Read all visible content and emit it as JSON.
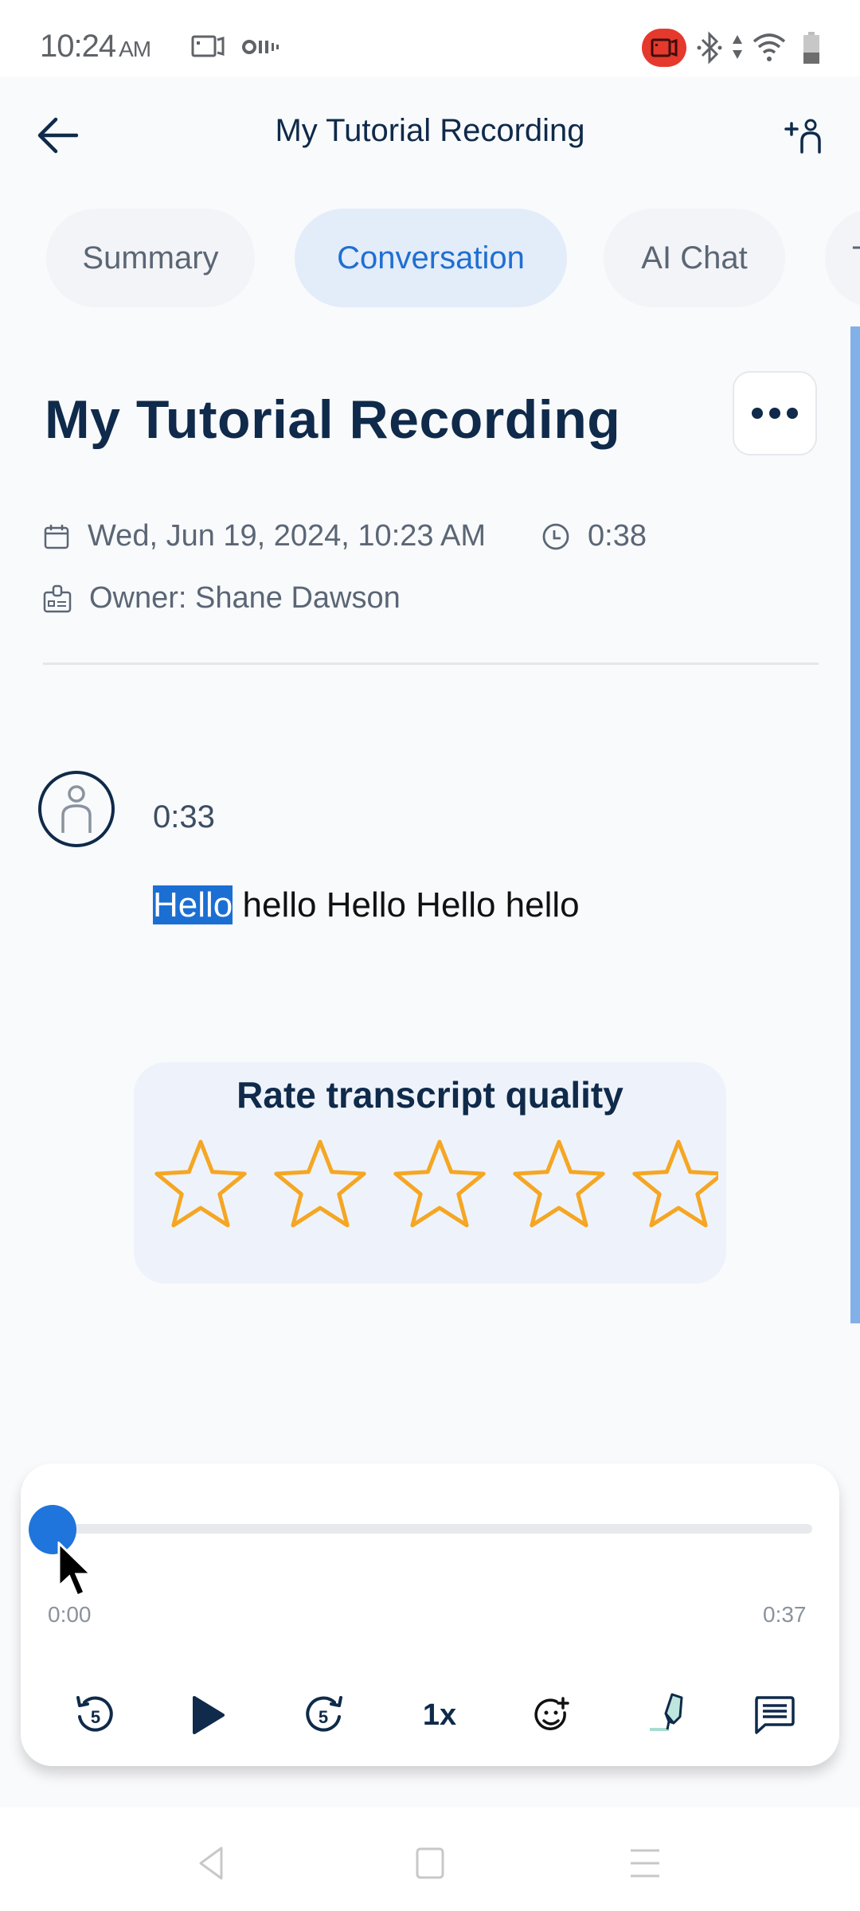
{
  "status_bar": {
    "time": "10:24",
    "ampm": "AM",
    "left_icons": [
      "screen-record-icon",
      "voicemail-icon"
    ],
    "right_icons": [
      "recording-badge-icon",
      "bluetooth-icon",
      "data-arrows-icon",
      "wifi-icon",
      "battery-icon"
    ],
    "recording_badge_color": "#e5392e"
  },
  "app_bar": {
    "back_icon": "arrow-left-icon",
    "title": "My Tutorial Recording",
    "add_user_icon": "add-person-icon"
  },
  "tabs": [
    {
      "label": "Summary",
      "active": false
    },
    {
      "label": "Conversation",
      "active": true
    },
    {
      "label": "AI Chat",
      "active": false
    },
    {
      "label": "T",
      "active": false
    }
  ],
  "document": {
    "title": "My Tutorial Recording",
    "more_icon": "more-horizontal-icon",
    "date": "Wed, Jun 19, 2024, 10:23 AM",
    "duration": "0:38",
    "owner": "Owner: Shane Dawson"
  },
  "conversation": {
    "segments": [
      {
        "speaker_icon": "person-icon",
        "timestamp": "0:33",
        "highlighted_word": "Hello",
        "rest_text": " hello Hello Hello hello"
      }
    ]
  },
  "rating": {
    "title": "Rate transcript quality",
    "max_stars": 5,
    "value": 0,
    "star_color": "#f5a623"
  },
  "player": {
    "current_time": "0:00",
    "total_time": "0:37",
    "progress": 0,
    "speed_label": "1x",
    "controls": [
      "rewind-5-icon",
      "play-icon",
      "forward-5-icon",
      "speed-button",
      "add-reaction-icon",
      "highlighter-icon",
      "comment-icon"
    ],
    "accent_color": "#1f75db"
  },
  "nav_bar": {
    "buttons": [
      "nav-back-icon",
      "nav-home-icon",
      "nav-recents-icon"
    ]
  }
}
